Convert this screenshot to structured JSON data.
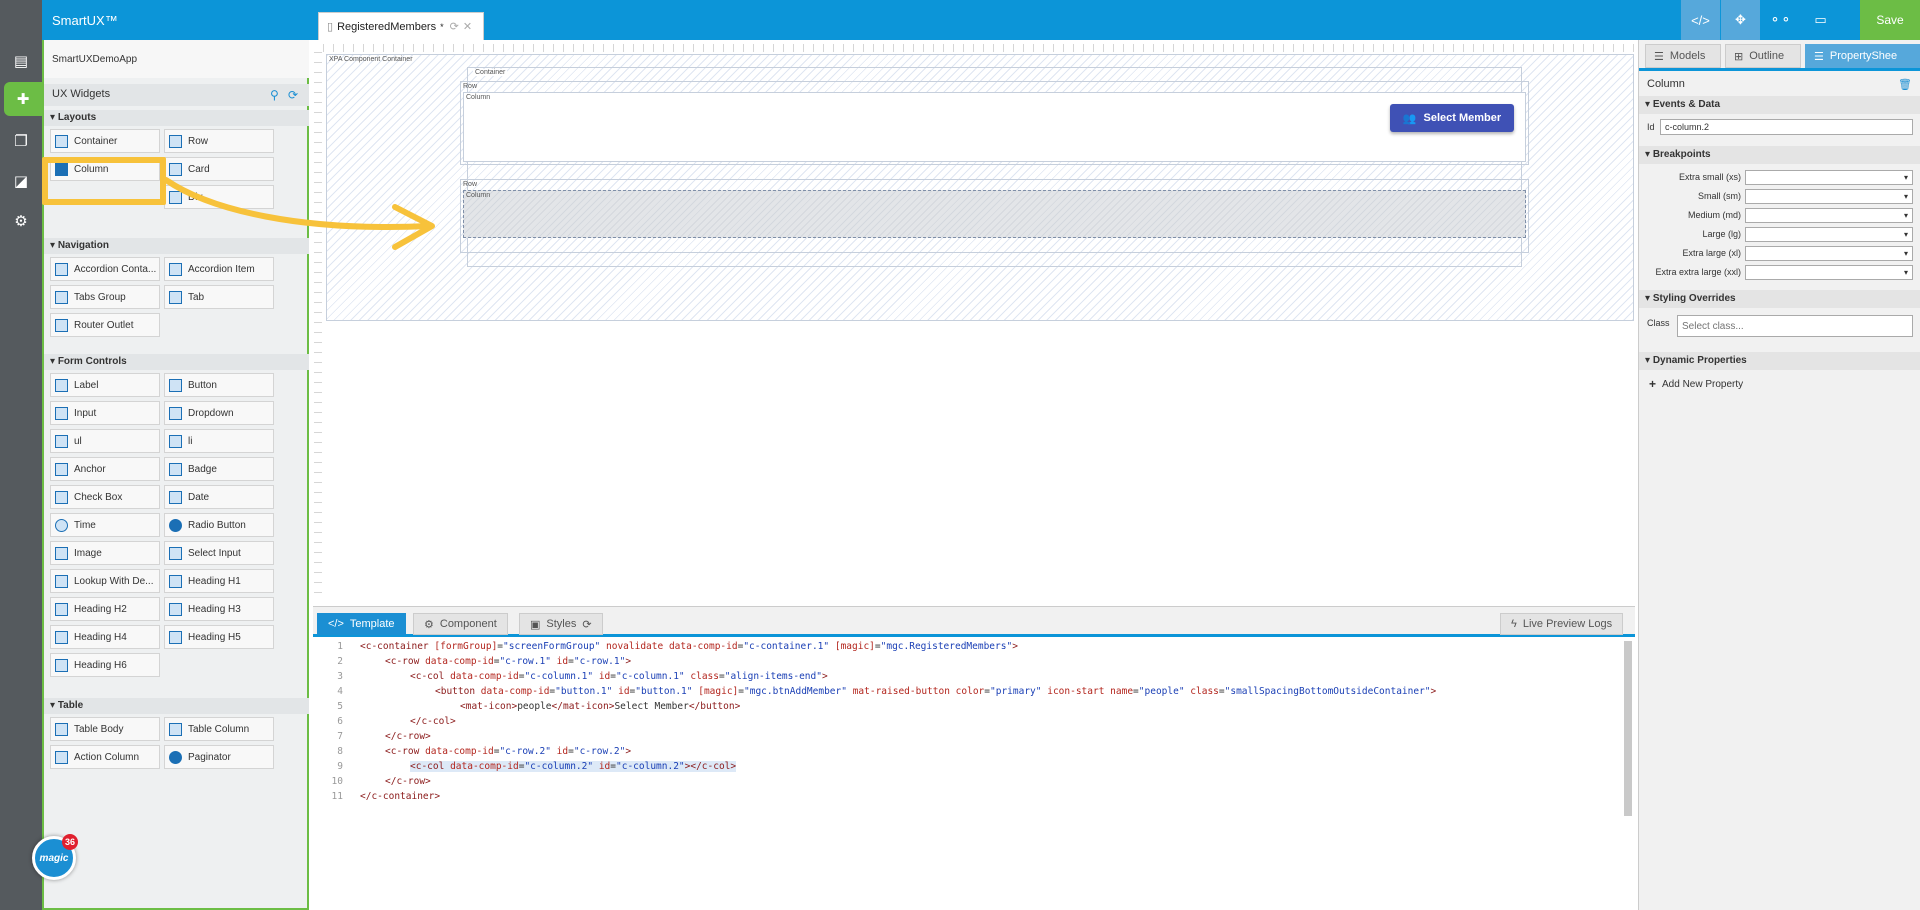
{
  "app": {
    "brand": "SmartUX™",
    "app_name": "SmartUXDemoApp",
    "save_label": "Save"
  },
  "document_tab": {
    "title": "RegisteredMembers",
    "modified_marker": "*"
  },
  "toolbar": {
    "icons": [
      "code-icon",
      "expand-icon",
      "share-icon",
      "monitor-icon"
    ]
  },
  "rail": {
    "icons": [
      "document-icon",
      "puzzle-icon",
      "pages-icon",
      "chart-icon",
      "gear-icon"
    ]
  },
  "magic": {
    "label": "magic",
    "count": "36"
  },
  "widgets": {
    "title": "UX Widgets",
    "sections": [
      {
        "name": "Layouts",
        "items": [
          "Container",
          "Row",
          "Column",
          "Card",
          "Div"
        ]
      },
      {
        "name": "Navigation",
        "items": [
          "Accordion Conta...",
          "Accordion Item",
          "Tabs Group",
          "Tab",
          "Router Outlet"
        ]
      },
      {
        "name": "Form Controls",
        "items": [
          "Label",
          "Button",
          "Input",
          "Dropdown",
          "ul",
          "li",
          "Anchor",
          "Badge",
          "Check Box",
          "Date",
          "Time",
          "Radio Button",
          "Image",
          "Select Input",
          "Lookup With De...",
          "Heading H1",
          "Heading H2",
          "Heading H3",
          "Heading H4",
          "Heading H5",
          "Heading H6"
        ]
      },
      {
        "name": "Table",
        "items": [
          "Table Body",
          "Table Column",
          "Action Column",
          "Paginator"
        ]
      }
    ]
  },
  "canvas": {
    "outer_label": "XPA Component Container",
    "container_label": "Container",
    "row1_label": "Row",
    "col1_label": "Column",
    "row2_label": "Row",
    "col2_label": "Column",
    "button_label": "Select Member"
  },
  "editor": {
    "tabs": [
      "Template",
      "Component",
      "Styles"
    ],
    "live_preview": "Live Preview Logs",
    "lines": [
      "1",
      "2",
      "3",
      "4",
      "5",
      "6",
      "7",
      "8",
      "9",
      "10",
      "11"
    ]
  },
  "props": {
    "tabs": [
      "Models",
      "Outline",
      "PropertyShee"
    ],
    "title": "Column",
    "sections": {
      "events": "Events & Data",
      "breakpoints": "Breakpoints",
      "styling": "Styling Overrides",
      "dynamic": "Dynamic Properties"
    },
    "id_label": "Id",
    "id_value": "c-column.2",
    "breakpoints": [
      "Extra small (xs)",
      "Small (sm)",
      "Medium (md)",
      "Large (lg)",
      "Extra large (xl)",
      "Extra extra large (xxl)"
    ],
    "class_label": "Class",
    "class_placeholder": "Select class...",
    "add_property": "Add New Property"
  }
}
